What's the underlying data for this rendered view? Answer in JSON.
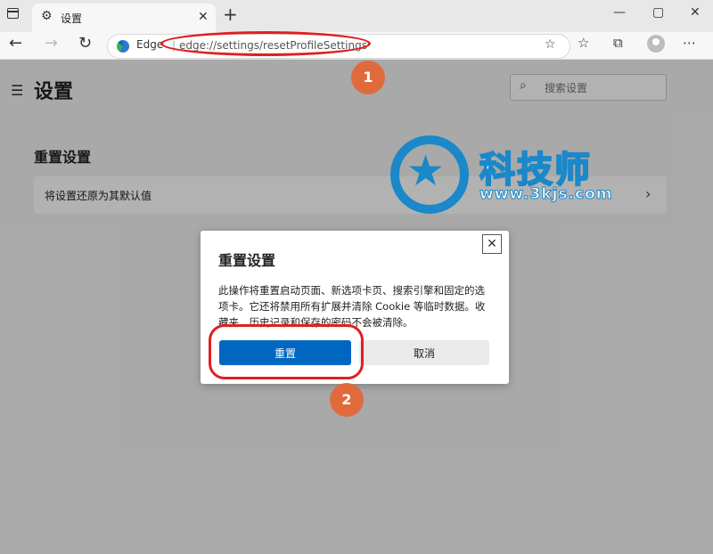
{
  "browser": {
    "tab_title": "设置",
    "tab_close": "✕",
    "new_tab": "+",
    "window_controls": [
      "—",
      "▢",
      "✕"
    ],
    "address_prefix": "Edge",
    "address_separator": "|",
    "address_url": "edge://settings/resetProfileSettings",
    "icons": [
      "back-icon",
      "forward-icon",
      "refresh-icon",
      "favorite-add-icon",
      "favorites-icon",
      "collections-icon",
      "profile-icon",
      "more-icon"
    ]
  },
  "page": {
    "title": "设置",
    "search_placeholder": "搜索设置",
    "section_title": "重置设置",
    "reset_row_label": "将设置还原为其默认值"
  },
  "watermark": {
    "name": "科技师",
    "url": "www.3kjs.com"
  },
  "dialog": {
    "title": "重置设置",
    "body": "此操作将重置启动页面、新选项卡页、搜索引擎和固定的选项卡。它还将禁用所有扩展并清除 Cookie 等临时数据。收藏夹、历史记录和保存的密码不会被清除。",
    "reset_label": "重置",
    "cancel_label": "取消",
    "close_glyph": "✕"
  },
  "annotations": {
    "step1": "1",
    "step2": "2",
    "color": "#e0201f",
    "badge_color": "#e06a3c"
  }
}
